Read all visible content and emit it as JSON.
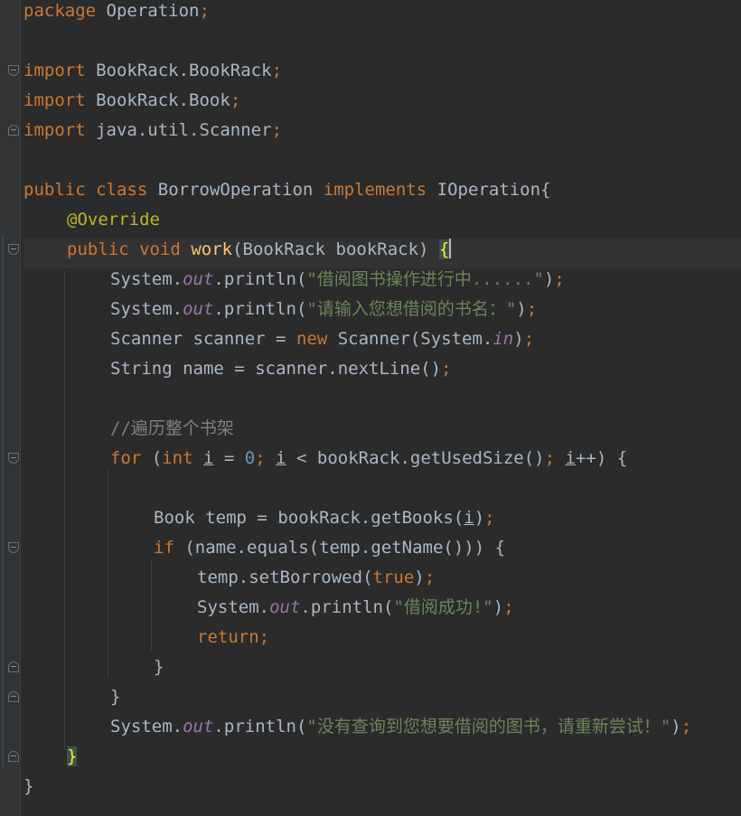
{
  "code": {
    "package_kw": "package",
    "package_name": "Operation",
    "import_kw": "import",
    "imports": [
      "BookRack.BookRack",
      "BookRack.Book",
      "java.util.Scanner"
    ],
    "public_kw": "public",
    "class_kw": "class",
    "class_name": "BorrowOperation",
    "implements_kw": "implements",
    "interface_name": "IOperation",
    "annotation": "@Override",
    "void_kw": "void",
    "method_name": "work",
    "param_type": "BookRack",
    "param_name": "bookRack",
    "system": "System",
    "out_field": "out",
    "in_field": "in",
    "println": "println",
    "str_borrowing": "\"借阅图书操作进行中......\"",
    "str_input": "\"请输入您想借阅的书名：\"",
    "scanner_type": "Scanner",
    "scanner_var": "scanner",
    "new_kw": "new",
    "string_type": "String",
    "name_var": "name",
    "next_line": "nextLine",
    "comment": "//遍历整个书架",
    "for_kw": "for",
    "int_kw": "int",
    "loop_var": "i",
    "zero": "0",
    "get_used_size": "getUsedSize",
    "book_type": "Book",
    "temp_var": "temp",
    "get_books": "getBooks",
    "if_kw": "if",
    "equals": "equals",
    "get_name": "getName",
    "set_borrowed": "setBorrowed",
    "true_kw": "true",
    "str_success": "\"借阅成功!\"",
    "return_kw": "return",
    "str_fail": "\"没有查询到您想要借阅的图书，请重新尝试！\""
  }
}
